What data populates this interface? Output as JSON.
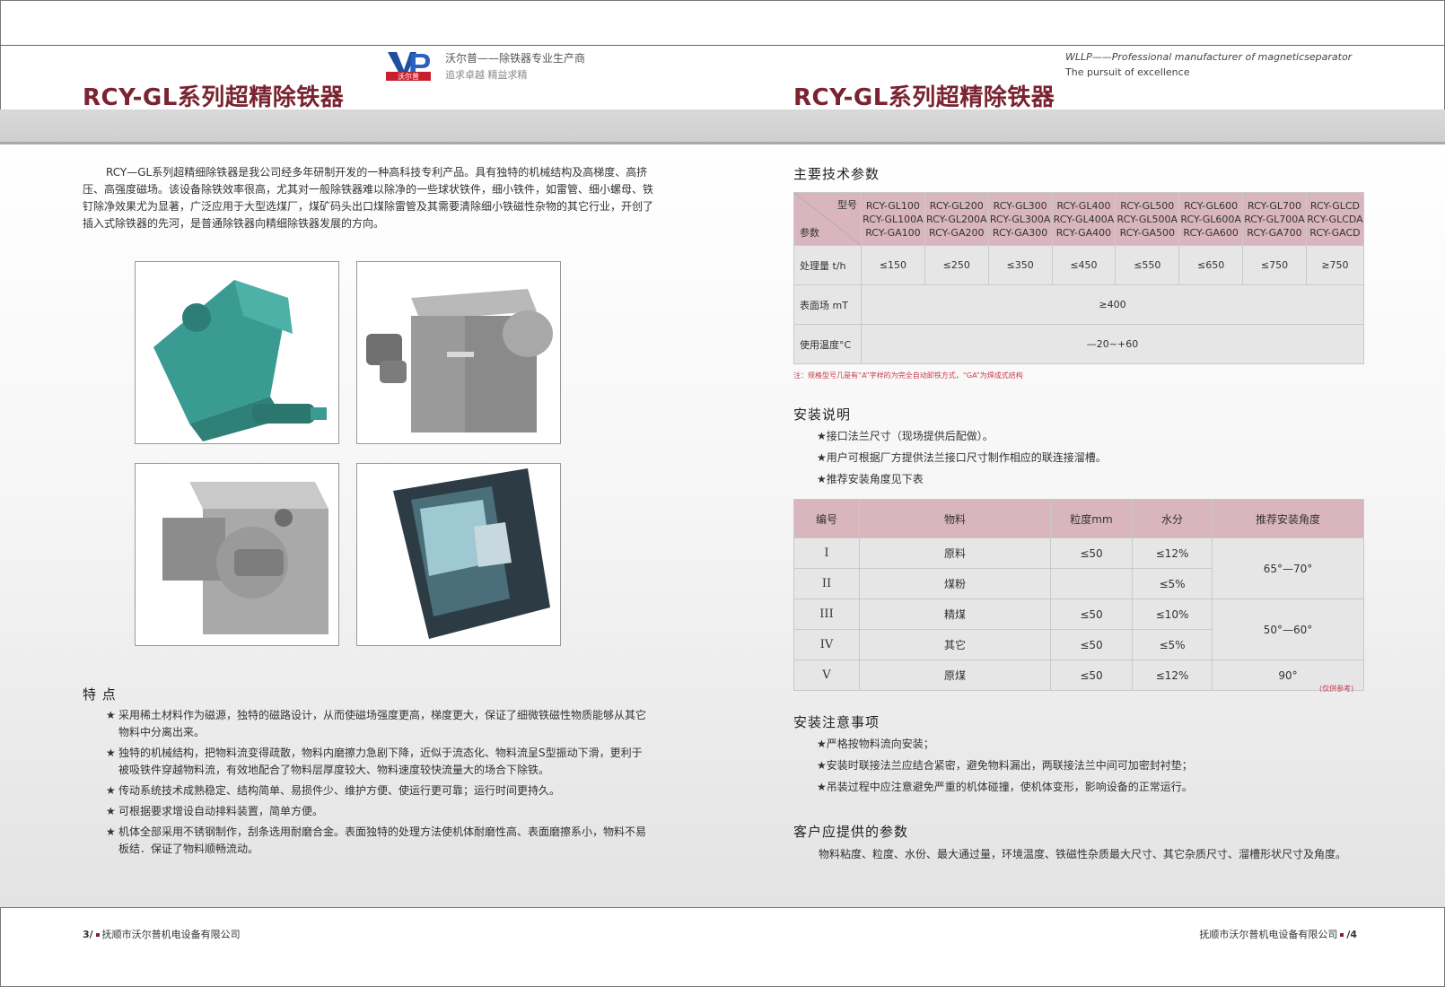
{
  "brand": {
    "logo_text": "沃尔普",
    "cn_line1": "沃尔普——除铁器专业生产商",
    "cn_line2": "追求卓越 精益求精",
    "en_line1": "WLLP——Professional manufacturer of magneticseparator",
    "en_line2": "The pursuit of excellence"
  },
  "left": {
    "title": "RCY-GL系列超精除铁器",
    "intro": "RCY—GL系列超精细除铁器是我公司经多年研制开发的一种高科技专利产品。具有独特的机械结构及高梯度、高挤压、高强度磁场。该设备除铁效率很高，尤其对一般除铁器难以除净的一些球状铁件，细小铁件，如雷管、细小螺母、铁钉除净效果尤为显著，广泛应用于大型选煤厂，煤矿码头出口煤除雷管及其需要清除细小铁磁性杂物的其它行业，开创了插入式除铁器的先河，是普通除铁器向精细除铁器发展的方向。",
    "features_heading": "特 点",
    "features": [
      "采用稀土材料作为磁源，独特的磁路设计，从而使磁场强度更高，梯度更大，保证了细微铁磁性物质能够从其它物料中分离出来。",
      "独特的机械结构，把物料流变得疏散，物料内磨擦力急剧下降，近似于流态化、物料流呈S型振动下滑，更利于被吸铁件穿越物料流，有效地配合了物料层厚度较大、物料速度较快流量大的场合下除铁。",
      "传动系统技术成熟稳定、结构简单、易损件少、维护方便、使运行更可靠；运行时间更持久。",
      "可根据要求增设自动排料装置，简单方便。",
      "机体全部采用不锈钢制作，刮条选用耐磨合金。表面独特的处理方法使机体耐磨性高、表面磨擦系小，物料不易板结．保证了物料顺畅流动。"
    ],
    "footer_page": "3/",
    "footer_company": "抚顺市沃尔普机电设备有限公司"
  },
  "right": {
    "title": "RCY-GL系列超精除铁器",
    "spec_heading": "主要技术参数",
    "spec_diag_top": "型号",
    "spec_diag_bottom": "参数",
    "spec_models": [
      "RCY-GL100 RCY-GL100A RCY-GA100",
      "RCY-GL200 RCY-GL200A RCY-GA200",
      "RCY-GL300 RCY-GL300A RCY-GA300",
      "RCY-GL400 RCY-GL400A RCY-GA400",
      "RCY-GL500 RCY-GL500A RCY-GA500",
      "RCY-GL600 RCY-GL600A RCY-GA600",
      "RCY-GL700 RCY-GL700A RCY-GA700",
      "RCY-GLCD RCY-GLCDA RCY-GACD"
    ],
    "spec_row1_label": "处理量 t/h",
    "spec_row1_values": [
      "≤150",
      "≤250",
      "≤350",
      "≤450",
      "≤550",
      "≤650",
      "≤750",
      "≥750"
    ],
    "spec_row2_label": "表面场 mT",
    "spec_row2_value": "≥400",
    "spec_row3_label": "使用温度°C",
    "spec_row3_value": "—20~+60",
    "spec_note": "注：规格型号几是有“A”字样的为完全自动卸铁方式，“GA”为焊成式结构",
    "install_heading": "安装说明",
    "install_items": [
      "★接口法兰尺寸（现场提供后配做）。",
      "★用户可根据厂方提供法兰接口尺寸制作相应的联连接溜槽。",
      "★推荐安装角度见下表"
    ],
    "angle_headers": [
      "编号",
      "物料",
      "粒度mm",
      "水分",
      "推荐安装角度"
    ],
    "angle_rows": [
      {
        "no": "I",
        "material": "原料",
        "size": "≤50",
        "water": "≤12%"
      },
      {
        "no": "II",
        "material": "煤粉",
        "size": "",
        "water": "≤5%"
      },
      {
        "no": "III",
        "material": "精煤",
        "size": "≤50",
        "water": "≤10%"
      },
      {
        "no": "IV",
        "material": "其它",
        "size": "≤50",
        "water": "≤5%"
      },
      {
        "no": "V",
        "material": "原煤",
        "size": "≤50",
        "water": "≤12%"
      }
    ],
    "angle_values": [
      "65°—70°",
      "50°—60°",
      "90°"
    ],
    "angle_note": "(仅供参考)",
    "caution_heading": "安装注意事项",
    "caution_items": [
      "★严格按物料流向安装；",
      "★安装时联接法兰应结合紧密，避免物料漏出，两联接法兰中间可加密封衬垫；",
      "★吊装过程中应注意避免严重的机体碰撞，使机体变形，影响设备的正常运行。"
    ],
    "client_heading": "客户应提供的参数",
    "client_text": "物料粘度、粒度、水份、最大通过量，环境温度、铁磁性杂质最大尺寸、其它杂质尺寸、溜槽形状尺寸及角度。",
    "footer_company": "抚顺市沃尔普机电设备有限公司",
    "footer_page": "/4"
  },
  "colors": {
    "title": "#7a2331",
    "table_header": "#d9b6bd",
    "note": "#c83a4a"
  }
}
